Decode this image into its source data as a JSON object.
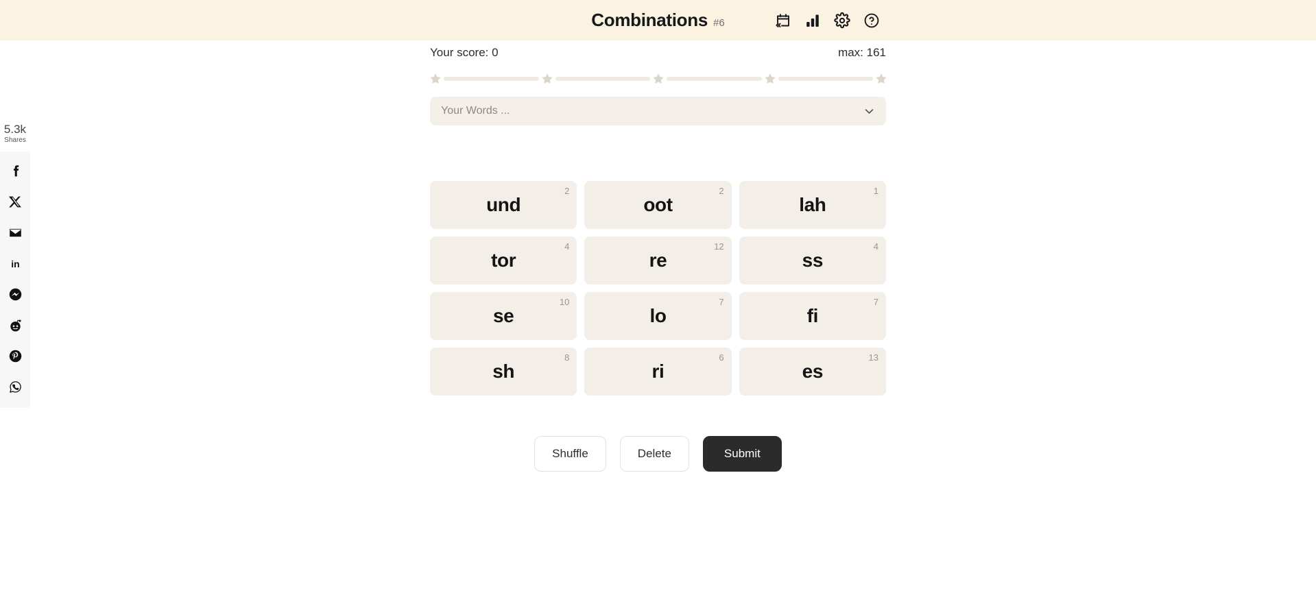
{
  "header": {
    "title": "Combinations",
    "puzzle_number": "#6",
    "icons": [
      {
        "name": "archive-calendar-icon",
        "label": "Archive"
      },
      {
        "name": "bar-chart-icon",
        "label": "Statistics"
      },
      {
        "name": "gear-icon",
        "label": "Settings"
      },
      {
        "name": "help-question-icon",
        "label": "Help"
      }
    ]
  },
  "score": {
    "your_score_label": "Your score: 0",
    "max_label": "max: 161",
    "stars_total": 5,
    "stars_earned": 0
  },
  "words_select": {
    "placeholder": "Your Words ...",
    "chevron": "chevron-down-icon"
  },
  "tiles": [
    {
      "label": "und",
      "count": "2"
    },
    {
      "label": "oot",
      "count": "2"
    },
    {
      "label": "lah",
      "count": "1"
    },
    {
      "label": "tor",
      "count": "4"
    },
    {
      "label": "re",
      "count": "12"
    },
    {
      "label": "ss",
      "count": "4"
    },
    {
      "label": "se",
      "count": "10"
    },
    {
      "label": "lo",
      "count": "7"
    },
    {
      "label": "fi",
      "count": "7"
    },
    {
      "label": "sh",
      "count": "8"
    },
    {
      "label": "ri",
      "count": "6"
    },
    {
      "label": "es",
      "count": "13"
    }
  ],
  "actions": {
    "shuffle": "Shuffle",
    "delete": "Delete",
    "submit": "Submit"
  },
  "share": {
    "count": "5.3k",
    "label": "Shares",
    "items": [
      {
        "name": "facebook-share-icon",
        "label": "Facebook"
      },
      {
        "name": "x-twitter-share-icon",
        "label": "X"
      },
      {
        "name": "email-share-icon",
        "label": "Email"
      },
      {
        "name": "linkedin-share-icon",
        "label": "LinkedIn"
      },
      {
        "name": "messenger-share-icon",
        "label": "Messenger"
      },
      {
        "name": "reddit-share-icon",
        "label": "Reddit"
      },
      {
        "name": "pinterest-share-icon",
        "label": "Pinterest"
      },
      {
        "name": "whatsapp-share-icon",
        "label": "WhatsApp"
      }
    ]
  },
  "colors": {
    "header_bg": "#FBF2E2",
    "page_bg": "#FFFFFF",
    "tile_bg": "#F3EEE7",
    "select_bg": "#F4EFE8",
    "submit_bg": "#2B2B2B",
    "star_inactive": "#DCD6CC",
    "text_primary": "#141414",
    "text_muted": "#9A948C"
  }
}
